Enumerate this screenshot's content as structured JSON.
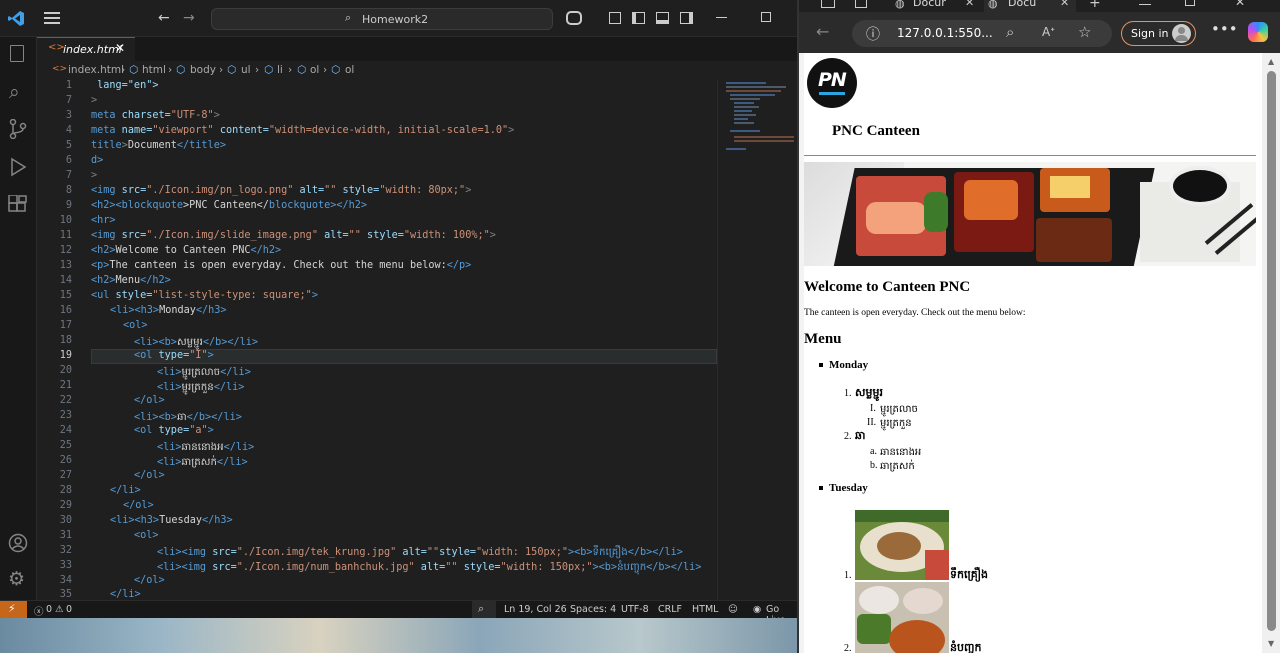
{
  "vscode": {
    "search_label": "Homework2",
    "tab_label": "index.html",
    "breadcrumbs": [
      "index.html",
      "html",
      "body",
      "ul",
      "li",
      "ol",
      "ol"
    ],
    "line_numbers": [
      "1",
      "7",
      "3",
      "4",
      "5",
      "6",
      "7",
      "8",
      "9",
      "10",
      "11",
      "12",
      "13",
      "14",
      "15",
      "16",
      "17",
      "18",
      "19",
      "20",
      "21",
      "22",
      "23",
      "24",
      "25",
      "26",
      "27",
      "28",
      "29",
      "30",
      "31",
      "32",
      "33",
      "34",
      "35"
    ],
    "code": {
      "l1": " lang=\"en\">",
      "l2": ">",
      "l3_tag": "meta",
      "l3_attr": " charset=",
      "l3_val": "\"UTF-8\"",
      "l4_tag": "meta",
      "l4_attr1": " name=",
      "l4_val1": "\"viewport\"",
      "l4_attr2": " content=",
      "l4_val2": "\"width=device-width, initial-scale=1.0\"",
      "l5_tag": "title",
      "l5_text": "Document",
      "l5_close": "</title>",
      "l6": "d>",
      "l7": ">",
      "l8_tag": "<img",
      "l8_attr": " src=",
      "l8_val": "\"./Icon.img/pn_logo.png\"",
      "l8_attr2": " alt=",
      "l8_val2": "\"\"",
      "l8_attr3": " style=",
      "l8_val3": "\"width: 80px;\"",
      "l9_a": "<h2><",
      "l9_b": "blockquote",
      "l9_c": ">PNC Canteen</",
      "l9_d": "blockquote",
      "l9_e": "></h2>",
      "l10": "<hr>",
      "l11_tag": "<img",
      "l11_attr": " src=",
      "l11_val": "\"./Icon.img/slide_image.png\"",
      "l11_attr2": " alt=",
      "l11_val2": "\"\"",
      "l11_attr3": " style=",
      "l11_val3": "\"width: 100%;\"",
      "l12_a": "<h2>",
      "l12_b": "Welcome to Canteen PNC",
      "l12_c": "</h2>",
      "l13_a": "<p>",
      "l13_b": "The canteen is open everyday. Check out the menu below:",
      "l13_c": "</p>",
      "l14_a": "<h2>",
      "l14_b": "Menu",
      "l14_c": "</h2>",
      "l15_a": "<ul",
      "l15_b": " style=",
      "l15_c": "\"list-style-type: square;\"",
      "l15_d": ">",
      "l16_a": "<li><h3>",
      "l16_b": "Monday",
      "l16_c": "</h3>",
      "l17": "<ol>",
      "l18_a": "<li><b>",
      "l18_b": "សម្លម្ជូរ",
      "l18_c": "</b></li>",
      "l19_a": "<ol",
      "l19_b": " type=",
      "l19_c": "\"I\"",
      "l19_d": ">",
      "l20_a": "<li>",
      "l20_b": "ម្ជូរត្រលាច",
      "l20_c": "</li>",
      "l21_a": "<li>",
      "l21_b": "ម្ជូរត្រកួន",
      "l21_c": "</li>",
      "l22": "</ol>",
      "l23_a": "<li><b>",
      "l23_b": "ឆា",
      "l23_c": "</b></li>",
      "l24_a": "<ol",
      "l24_b": " type=",
      "l24_c": "\"a\"",
      "l24_d": ">",
      "l25_a": "<li>",
      "l25_b": "ឆាននោងអ",
      "l25_c": "</li>",
      "l26_a": "<li>",
      "l26_b": "ឆាត្រសក់",
      "l26_c": "</li>",
      "l27": "</ol>",
      "l28": "</li>",
      "l29": "</ol>",
      "l30_a": "<li><h3>",
      "l30_b": "Tuesday",
      "l30_c": "</h3>",
      "l31": "<ol>",
      "l32_a": "<li><img",
      "l32_b": " src=",
      "l32_c": "\"./Icon.img/tek_krung.jpg\"",
      "l32_d": " alt=",
      "l32_e": "\"\"",
      "l32_f": "style=",
      "l32_g": "\"width: 150px;\"",
      "l32_h": "><b>ទឹកគ្រឿង</b></li>",
      "l33_a": "<li><img",
      "l33_b": " src=",
      "l33_c": "\"./Icon.img/num_banhchuk.jpg\"",
      "l33_d": " alt=",
      "l33_e": "\"\"",
      "l33_f": " style=",
      "l33_g": "\"width: 150px;\"",
      "l33_h": "><b>នំបញ្ចុក</b></li>",
      "l34": "</ol>",
      "l35": "</li>"
    },
    "status": {
      "errors": "0",
      "warnings": "0",
      "position": "Ln 19, Col 26",
      "spaces": "Spaces: 4",
      "encoding": "UTF-8",
      "eol": "CRLF",
      "language": "HTML",
      "golive": "Go Live"
    }
  },
  "browser": {
    "tab1": "Docur",
    "tab2": "Docu",
    "address": "127.0.0.1:550...",
    "sign_in": "Sign in",
    "page": {
      "logo_text": "PN",
      "title": "PNC Canteen",
      "welcome": "Welcome to Canteen PNC",
      "intro": "The canteen is open everyday. Check out the menu below:",
      "menu": "Menu",
      "monday": "Monday",
      "m1": "សម្លម្ជូរ",
      "m1a": "ម្ជូរត្រលាច",
      "m1b": "ម្ជូរត្រកួន",
      "m2": "ឆា",
      "m2a": "ឆាននោងអ",
      "m2b": "ឆាត្រសក់",
      "tuesday": "Tuesday",
      "t1": "ទឹកគ្រឿង",
      "t2": "នំបញ្ចុក"
    }
  }
}
